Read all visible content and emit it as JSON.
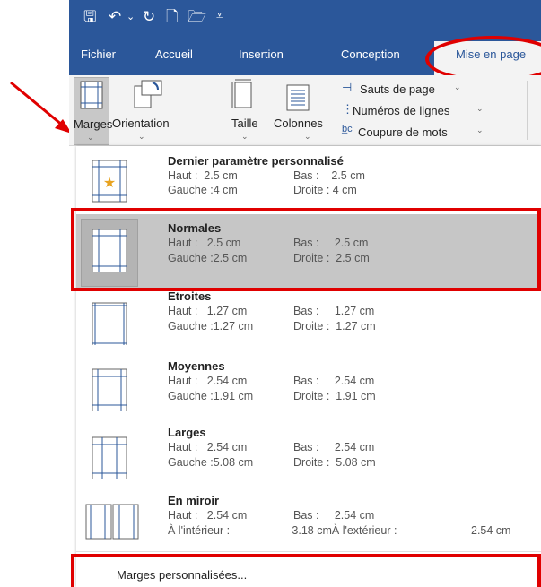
{
  "titlebar": {
    "icons": [
      "save-icon",
      "undo-icon",
      "redo-icon",
      "new-document-icon",
      "open-folder-icon",
      "customize-qat-icon"
    ]
  },
  "tabs": [
    {
      "label": "Fichier"
    },
    {
      "label": "Accueil"
    },
    {
      "label": "Insertion"
    },
    {
      "label": "Conception"
    },
    {
      "label": "Mise en page"
    }
  ],
  "ribbon": {
    "marges": "Marges",
    "orientation": "Orientation",
    "taille": "Taille",
    "colonnes": "Colonnes",
    "sauts": "Sauts de page",
    "numeros": "Numéros de lignes",
    "coupure": "Coupure de mots"
  },
  "menu": {
    "items": [
      {
        "name": "Dernier paramètre personnalisé",
        "l1": "Haut :  2.5 cm",
        "c1": "Bas :    2.5 cm",
        "l2": "Gauche :4 cm",
        "c2": "Droite : 4 cm"
      },
      {
        "name": "Normales",
        "l1": "Haut :   2.5 cm",
        "c1": "Bas :     2.5 cm",
        "l2": "Gauche :2.5 cm",
        "c2": "Droite :  2.5 cm"
      },
      {
        "name": "Etroites",
        "l1": "Haut :   1.27 cm",
        "c1": "Bas :     1.27 cm",
        "l2": "Gauche :1.27 cm",
        "c2": "Droite :  1.27 cm"
      },
      {
        "name": "Moyennes",
        "l1": "Haut :   2.54 cm",
        "c1": "Bas :     2.54 cm",
        "l2": "Gauche :1.91 cm",
        "c2": "Droite :  1.91 cm"
      },
      {
        "name": "Larges",
        "l1": "Haut :   2.54 cm",
        "c1": "Bas :     2.54 cm",
        "l2": "Gauche :5.08 cm",
        "c2": "Droite :  5.08 cm"
      },
      {
        "name": "En miroir",
        "l1": "Haut :   2.54 cm",
        "c1": "Bas :     2.54 cm",
        "l2": "À l'intérieur :",
        "c2": "   3.18 cmÀ l'extérieur :",
        "c3": "2.54 cm"
      }
    ],
    "custom": "Marges personnalisées..."
  },
  "colors": {
    "accent": "#2b579a",
    "highlight": "#e00000",
    "selected": "#c6c6c6"
  }
}
